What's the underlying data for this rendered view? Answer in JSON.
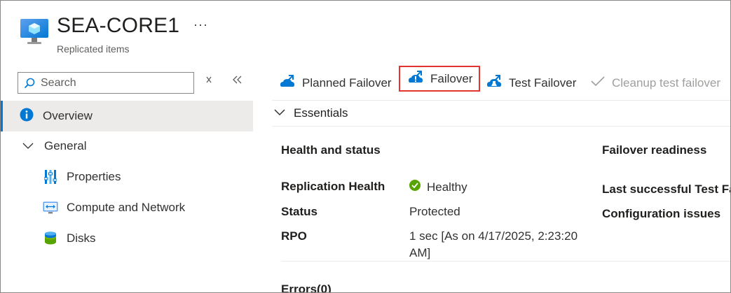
{
  "header": {
    "title": "SEA-CORE1",
    "subtitle": "Replicated items",
    "more_label": "···"
  },
  "sidebar": {
    "search_placeholder": "Search",
    "items": [
      {
        "label": "Overview",
        "icon": "info-icon"
      },
      {
        "label": "General",
        "icon": "chevron-down-icon"
      },
      {
        "label": "Properties",
        "icon": "properties-icon"
      },
      {
        "label": "Compute and Network",
        "icon": "network-icon"
      },
      {
        "label": "Disks",
        "icon": "disks-icon"
      }
    ]
  },
  "toolbar": {
    "planned_failover": "Planned Failover",
    "failover": "Failover",
    "test_failover": "Test Failover",
    "cleanup": "Cleanup test failover"
  },
  "essentials": {
    "title": "Essentials",
    "health_heading": "Health and status",
    "readiness_heading": "Failover readiness",
    "fields": [
      {
        "label": "Replication Health",
        "value": "Healthy"
      },
      {
        "label": "Status",
        "value": "Protected"
      },
      {
        "label": "RPO",
        "value_line1": "1 sec [As on 4/17/2025, 2:23:20",
        "value_line2": "AM]"
      }
    ],
    "readiness_fields": [
      {
        "label": "Last successful Test Fa"
      },
      {
        "label": "Configuration issues"
      }
    ],
    "errors_heading": "Errors(0)"
  },
  "colors": {
    "accent": "#0078d4",
    "highlight_border": "#e3342f",
    "healthy_green": "#57a300",
    "selected_bg": "#edebe9"
  }
}
